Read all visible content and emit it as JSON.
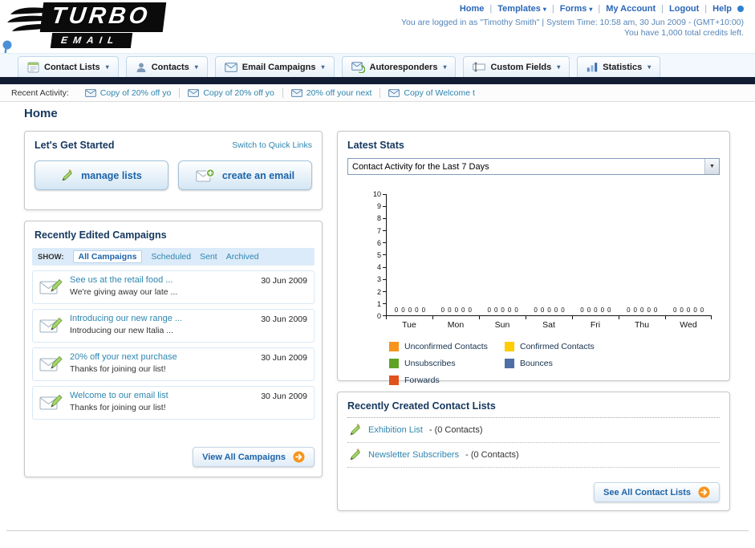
{
  "colors": {
    "accent_blue": "#1d64a8",
    "link_teal": "#2e86b0",
    "dark_navy": "#15375e",
    "dark_bar": "#121c33",
    "orange": "#f7941d"
  },
  "header": {
    "logo_title": "TURBO",
    "logo_subtitle": "EMAIL",
    "top_links": [
      {
        "label": "Home"
      },
      {
        "label": "Templates",
        "dropdown": true
      },
      {
        "label": "Forms",
        "dropdown": true
      },
      {
        "label": "My Account"
      },
      {
        "label": "Logout"
      },
      {
        "label": "Help"
      }
    ],
    "login_info": "You are logged in as \"Timothy Smith\" | System Time: 10:58 am, 30 Jun 2009 - (GMT+10:00)",
    "credits_info": "You have 1,000 total credits left."
  },
  "nav": {
    "items": [
      {
        "label": "Contact Lists",
        "icon": "contact-lists-icon"
      },
      {
        "label": "Contacts",
        "icon": "contacts-icon"
      },
      {
        "label": "Email Campaigns",
        "icon": "email-campaigns-icon"
      },
      {
        "label": "Autoresponders",
        "icon": "autoresponders-icon"
      },
      {
        "label": "Custom Fields",
        "icon": "custom-fields-icon"
      },
      {
        "label": "Statistics",
        "icon": "statistics-icon"
      }
    ]
  },
  "recent_activity": {
    "label": "Recent Activity:",
    "items": [
      "Copy of 20% off yo",
      "Copy of 20% off yo",
      "20% off your next",
      "Copy of Welcome t"
    ]
  },
  "page_title": "Home",
  "get_started": {
    "title": "Let's Get Started",
    "switch_link": "Switch to Quick Links",
    "buttons": [
      {
        "label": "manage lists"
      },
      {
        "label": "create an email"
      }
    ]
  },
  "campaigns": {
    "title": "Recently Edited Campaigns",
    "show_label": "SHOW:",
    "tabs": [
      "All Campaigns",
      "Scheduled",
      "Sent",
      "Archived"
    ],
    "active_tab": "All Campaigns",
    "rows": [
      {
        "title": "See us at the retail food ...",
        "subtitle": "We're giving away our late ...",
        "date": "30 Jun 2009"
      },
      {
        "title": "Introducing our new range ...",
        "subtitle": "Introducing our new Italia ...",
        "date": "30 Jun 2009"
      },
      {
        "title": "20% off your next purchase",
        "subtitle": "Thanks for joining our list!",
        "date": "30 Jun 2009"
      },
      {
        "title": "Welcome to our email list",
        "subtitle": "Thanks for joining our list!",
        "date": "30 Jun 2009"
      }
    ],
    "view_all_label": "View All Campaigns"
  },
  "stats": {
    "title": "Latest Stats",
    "dropdown_value": "Contact Activity for the Last 7 Days",
    "chart_data": {
      "type": "bar",
      "title": "Contact Activity for the Last 7 Days",
      "categories": [
        "Tue",
        "Mon",
        "Sun",
        "Sat",
        "Fri",
        "Thu",
        "Wed"
      ],
      "series": [
        {
          "name": "Unconfirmed Contacts",
          "color": "#f7941d",
          "values": [
            0,
            0,
            0,
            0,
            0,
            0,
            0
          ]
        },
        {
          "name": "Confirmed Contacts",
          "color": "#ffcc00",
          "values": [
            0,
            0,
            0,
            0,
            0,
            0,
            0
          ]
        },
        {
          "name": "Unsubscribes",
          "color": "#60a225",
          "values": [
            0,
            0,
            0,
            0,
            0,
            0,
            0
          ]
        },
        {
          "name": "Bounces",
          "color": "#4d6fa5",
          "values": [
            0,
            0,
            0,
            0,
            0,
            0,
            0
          ]
        },
        {
          "name": "Forwards",
          "color": "#e2521d",
          "values": [
            0,
            0,
            0,
            0,
            0,
            0,
            0
          ]
        }
      ],
      "xlabel": "",
      "ylabel": "",
      "ylim": [
        0,
        10
      ],
      "yticks": [
        0,
        1,
        2,
        3,
        4,
        5,
        6,
        7,
        8,
        9,
        10
      ],
      "grid": false,
      "legend_position": "bottom"
    }
  },
  "contact_lists": {
    "title": "Recently Created Contact Lists",
    "items": [
      {
        "name": "Exhibition List",
        "suffix": "- (0 Contacts)"
      },
      {
        "name": "Newsletter Subscribers",
        "suffix": "- (0 Contacts)"
      }
    ],
    "see_all_label": "See All Contact Lists"
  }
}
